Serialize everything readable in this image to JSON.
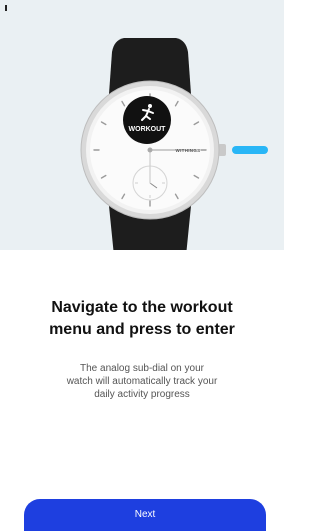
{
  "hero": {
    "workout_label": "WORKOUT",
    "brand_label": "WITHINGS",
    "icon": "running-person-icon",
    "indicator_color": "#29b6f6"
  },
  "content": {
    "title": "Navigate to the workout\nmenu and press to enter",
    "body": "The analog sub-dial on your\nwatch will automatically track your\ndaily activity progress"
  },
  "actions": {
    "next_label": "Next",
    "next_color": "#1e3fe0"
  }
}
